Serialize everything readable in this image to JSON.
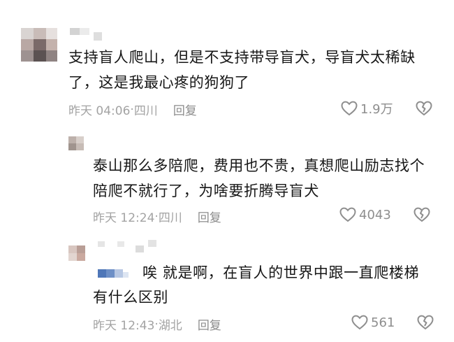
{
  "comments": [
    {
      "text": "支持盲人爬山，但是不支持带导盲犬，导盲犬太稀缺了，这是我最心疼的狗狗了",
      "time": "昨天 04:06",
      "dot": "·",
      "location": "四川",
      "reply_label": "回复",
      "likes": "1.9万"
    },
    {
      "text": "泰山那么多陪爬，费用也不贵，真想爬山励志找个陪爬不就行了，为啥要折腾导盲犬",
      "time": "昨天 12:24",
      "dot": "·",
      "location": "四川",
      "reply_label": "回复",
      "likes": "4043"
    },
    {
      "text_line1": "唉 就是啊，在盲人的世界中跟一直爬楼梯",
      "text_line2": "有什么区别",
      "time": "昨天 12:43",
      "dot": "·",
      "location": "湖北",
      "reply_label": "回复",
      "likes": "561"
    }
  ],
  "icons": {
    "like": "heart-outline-icon",
    "dislike": "broken-heart-icon"
  },
  "colors": {
    "text": "#161616",
    "meta": "#9a9a9a",
    "icon": "#8e8e8e"
  }
}
